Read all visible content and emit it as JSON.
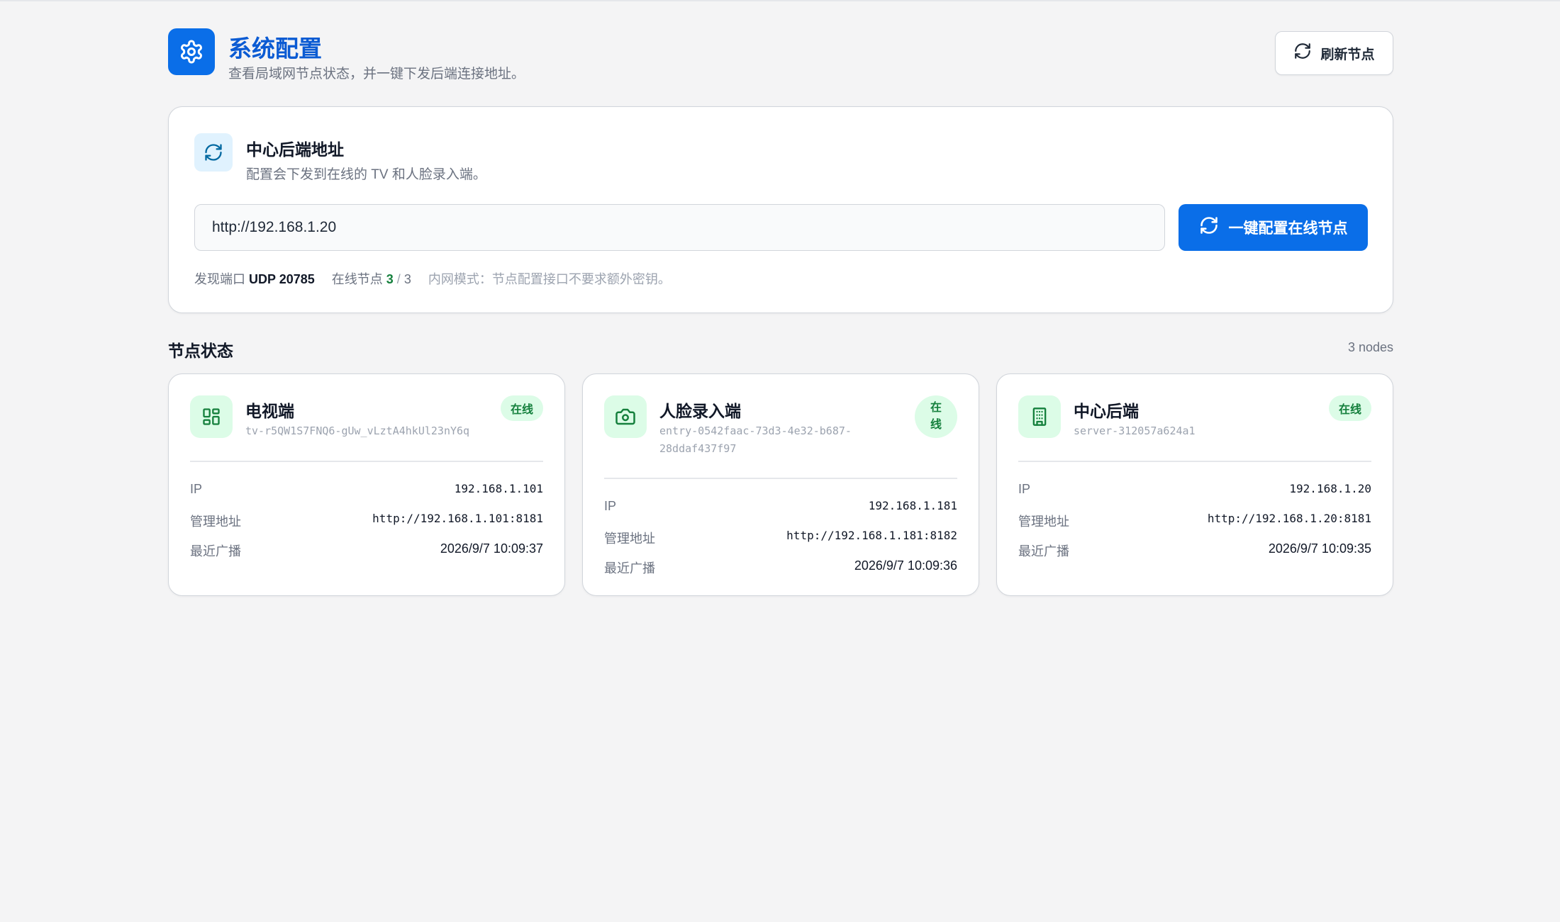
{
  "header": {
    "title": "系统配置",
    "subtitle": "查看局域网节点状态，并一键下发后端连接地址。",
    "refresh_label": "刷新节点"
  },
  "config": {
    "title": "中心后端地址",
    "subtitle": "配置会下发到在线的 TV 和人脸录入端。",
    "url_value": "http://192.168.1.20",
    "apply_label": "一键配置在线节点",
    "port_label": "发现端口",
    "port_value": "UDP 20785",
    "online_label": "在线节点",
    "online_count": "3",
    "online_sep": "/",
    "online_total": "3",
    "mode_note": "内网模式：节点配置接口不要求额外密钥。"
  },
  "nodes_section": {
    "title": "节点状态",
    "count": "3 nodes"
  },
  "colors": {
    "primary": "#0a6ee8",
    "title": "#0b5bd3",
    "online_green": "#15803d",
    "online_bg": "#dcfce7"
  },
  "nodes": [
    {
      "name": "电视端",
      "id": "tv-r5QW1S7FNQ6-gUw_vLztA4hkUl23nY6q",
      "status": "在线",
      "icon": "grid-icon",
      "ip_label": "IP",
      "ip": "192.168.1.101",
      "admin_label": "管理地址",
      "admin": "http://192.168.1.101:8181",
      "last_label": "最近广播",
      "last": "2026/9/7 10:09:37"
    },
    {
      "name": "人脸录入端",
      "id_line1": "entry-0542faac-73d3-4e32-b687-",
      "id_line2": "28ddaf437f97",
      "status_line1": "在",
      "status_line2": "线",
      "icon": "camera-icon",
      "ip_label": "IP",
      "ip": "192.168.1.181",
      "admin_label": "管理地址",
      "admin": "http://192.168.1.181:8182",
      "last_label": "最近广播",
      "last": "2026/9/7 10:09:36"
    },
    {
      "name": "中心后端",
      "id": "server-312057a624a1",
      "status": "在线",
      "icon": "building-icon",
      "ip_label": "IP",
      "ip": "192.168.1.20",
      "admin_label": "管理地址",
      "admin": "http://192.168.1.20:8181",
      "last_label": "最近广播",
      "last": "2026/9/7 10:09:35"
    }
  ]
}
